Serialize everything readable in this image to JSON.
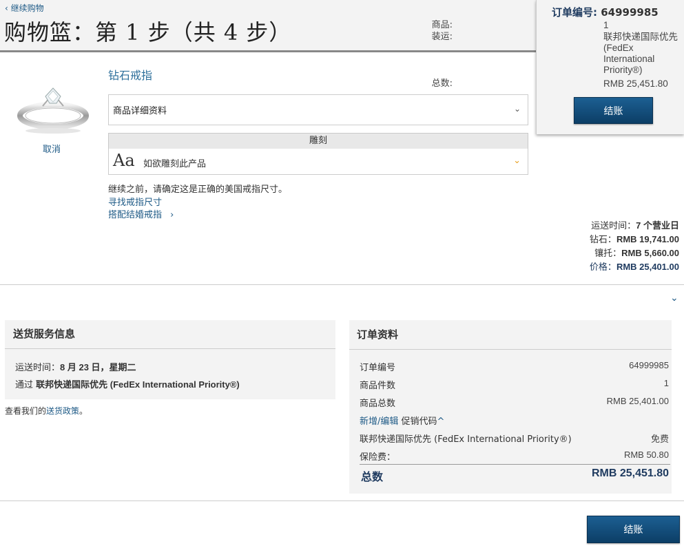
{
  "header": {
    "back_link": "‹ 继续购物",
    "title": "购物篮：第 1 步（共 4 步）"
  },
  "summary": {
    "order_label": "订单编号:",
    "order_number": "64999985",
    "items_label": "商品:",
    "items_value": "1",
    "shipping_label": "装运:",
    "shipping_value": "联邦快递国际优先 (FedEx International Priority®)",
    "total_label": "总数:",
    "total_value": "RMB 25,451.80",
    "checkout_label": "结账"
  },
  "item": {
    "title": "钻石戒指",
    "cancel_label": "取消",
    "details_select": "商品详细资料",
    "engrave_header": "雕刻",
    "engrave_icon_text": "Aa",
    "engrave_prompt": "如欲雕刻此产品",
    "size_note": "继续之前，请确定这是正确的美国戒指尺寸。",
    "find_size_link": "寻找戒指尺寸",
    "match_band_link": "搭配结婚戒指",
    "match_band_arrow": "›"
  },
  "pricing": {
    "ship_time_label": "运送时间：",
    "ship_time_value": "7 个营业日",
    "diamond_label": "钻石：",
    "diamond_value": "RMB 19,741.00",
    "setting_label": "镶托：",
    "setting_value": "RMB 5,660.00",
    "price_label": "价格：",
    "price_value": "RMB 25,401.00"
  },
  "shipping_info": {
    "heading": "送货服务信息",
    "time_label": "运送时间：",
    "time_value": "8 月 23 日，星期二",
    "via_label": "通过",
    "via_value": "联邦快递国际优先 (FedEx International Priority®)",
    "policy_prefix": "查看我们的",
    "policy_link": "送货政策",
    "policy_suffix": "。"
  },
  "order_info": {
    "heading": "订单资料",
    "rows": [
      {
        "label": "订单编号",
        "value": "64999985"
      },
      {
        "label": "商品件数",
        "value": "1"
      },
      {
        "label": "商品总数",
        "value": "RMB 25,401.00"
      },
      {
        "label": "联邦快递国际优先 (FedEx International Priority®)",
        "value": "免费"
      },
      {
        "label": "保险费：",
        "value": "RMB 50.80"
      }
    ],
    "promo_link": "新增/编辑",
    "promo_text": "促销代码",
    "promo_caret": "^",
    "total_label": "总数",
    "total_value": "RMB 25,451.80"
  },
  "footer": {
    "checkout_label": "结账"
  },
  "icons": {
    "details_chevron": "chevron-down-icon",
    "engrave_chevron": "chevron-down-icon",
    "expand_chevron": "chevron-down-icon"
  },
  "colors": {
    "accent_blue": "#1e5a86",
    "button_dark": "#0c3e66",
    "engrave_chevron": "#e8a020"
  }
}
